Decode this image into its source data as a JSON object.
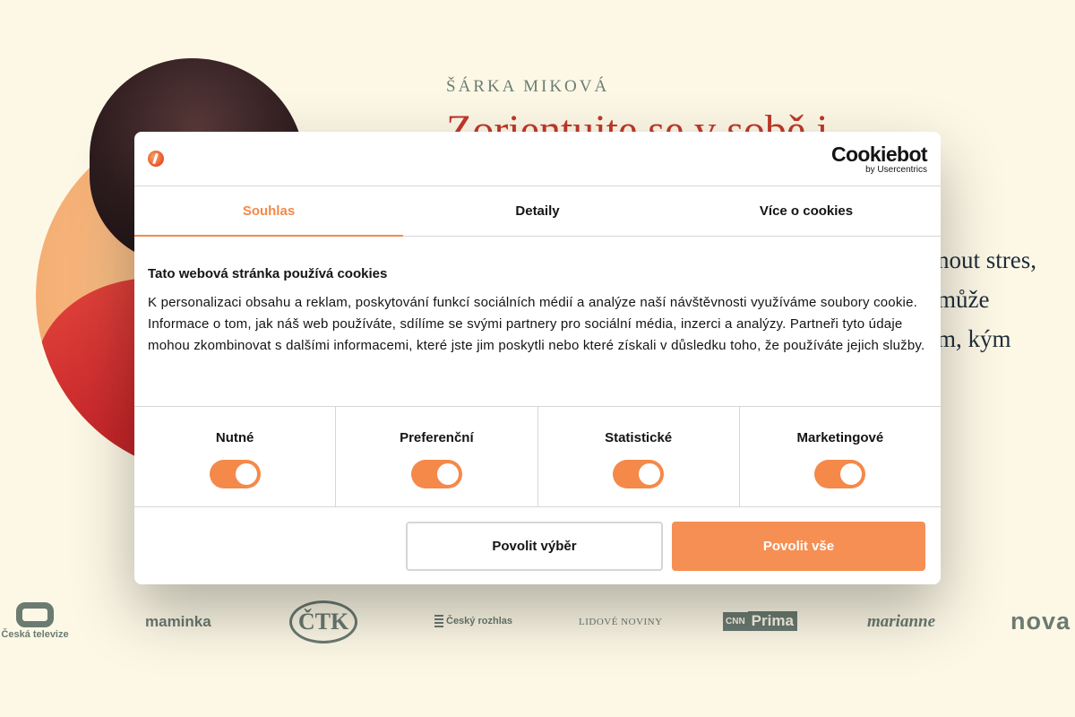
{
  "page": {
    "author": "ŠÁRKA MIKOVÁ",
    "headline": "Zorientujte se v sobě i",
    "lead_lines": [
      "nout stres,",
      "může",
      "m, kým"
    ]
  },
  "logos": {
    "ceska_televize": "Česká televize",
    "maminka": "maminka",
    "ctk": "ČTK",
    "cesky_rozhlas": "Český rozhlas",
    "lidove_noviny": "LIDOVÉ NOVINY",
    "cnn": "CNN",
    "prima": "Prima",
    "marianne": "marianne",
    "nova": "nova"
  },
  "cookie_dialog": {
    "provider": "Cookiebot",
    "provider_by": "by Usercentrics",
    "tabs": [
      {
        "label": "Souhlas",
        "active": true
      },
      {
        "label": "Detaily",
        "active": false
      },
      {
        "label": "Více o cookies",
        "active": false
      }
    ],
    "title": "Tato webová stránka používá cookies",
    "text": "K personalizaci obsahu a reklam, poskytování funkcí sociálních médií a analýze naší návštěvnosti využíváme soubory cookie. Informace o tom, jak náš web používáte, sdílíme se svými partnery pro sociální média, inzerci a analýzy. Partneři tyto údaje mohou zkombinovat s dalšími informacemi, které jste jim poskytli nebo které získali v důsledku toho, že používáte jejich služby.",
    "categories": [
      {
        "label": "Nutné",
        "enabled": true
      },
      {
        "label": "Preferenční",
        "enabled": true
      },
      {
        "label": "Statistické",
        "enabled": true
      },
      {
        "label": "Marketingové",
        "enabled": true
      }
    ],
    "buttons": {
      "allow_selection": "Povolit výběr",
      "allow_all": "Povolit vše"
    }
  },
  "colors": {
    "accent": "#f68f53",
    "page_background": "#fdf8e6",
    "headline": "#c0392b"
  }
}
